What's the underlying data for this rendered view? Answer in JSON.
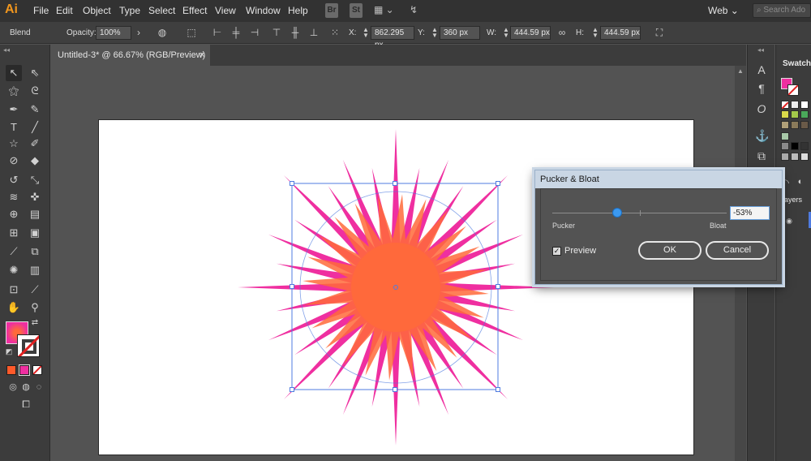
{
  "app": {
    "logo": "Ai",
    "menu": [
      "File",
      "Edit",
      "Object",
      "Type",
      "Select",
      "Effect",
      "View",
      "Window",
      "Help"
    ],
    "bridge": "Br",
    "stock": "St",
    "workspace": "Web",
    "search_placeholder": "Search Ado"
  },
  "control_bar": {
    "mode": "Blend",
    "opacity_label": "Opacity:",
    "opacity_value": "100%",
    "x_label": "X:",
    "x_value": "862.295 px",
    "y_label": "Y:",
    "y_value": "360 px",
    "w_label": "W:",
    "w_value": "444.59 px",
    "h_label": "H:",
    "h_value": "444.59 px"
  },
  "document": {
    "tab_title": "Untitled-3* @ 66.67% (RGB/Preview)",
    "close": "×"
  },
  "panels": {
    "swatches_tab": "Swatches",
    "layers_tab": "ayers"
  },
  "dialog": {
    "title": "Pucker & Bloat",
    "value": "-53%",
    "slider_fraction": 0.37,
    "left_label": "Pucker",
    "right_label": "Bloat",
    "preview_label": "Preview",
    "preview_checked": true,
    "ok_label": "OK",
    "cancel_label": "Cancel"
  },
  "colors": {
    "fill": "#ef2fa0",
    "fill_inner": "#ff6a3a",
    "selection": "#4f7be0",
    "accent": "#3b99f0"
  }
}
